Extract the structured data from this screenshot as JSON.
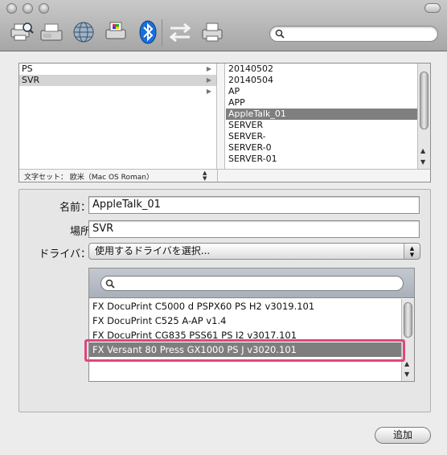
{
  "toolbar": {
    "icons": [
      "printer-search-icon",
      "fax-icon",
      "network-globe-icon",
      "windows-printer-icon",
      "bluetooth-icon",
      "transfer-arrows-icon",
      "printer-icon"
    ],
    "search_placeholder": ""
  },
  "browser": {
    "column1": [
      {
        "label": "PS",
        "state": "normal"
      },
      {
        "label": "SVR",
        "state": "selected"
      },
      {
        "label": "",
        "state": "normal"
      }
    ],
    "column2": [
      {
        "label": "20140502",
        "state": "normal"
      },
      {
        "label": "20140504",
        "state": "normal"
      },
      {
        "label": "AP",
        "state": "normal"
      },
      {
        "label": "APP",
        "state": "normal"
      },
      {
        "label": "AppleTalk_01",
        "state": "selected"
      },
      {
        "label": "SERVER",
        "state": "normal"
      },
      {
        "label": "SERVER-",
        "state": "normal"
      },
      {
        "label": "SERVER-0",
        "state": "normal"
      },
      {
        "label": "SERVER-01",
        "state": "normal"
      }
    ],
    "encoding_label": "文字セット： 欧米（Mac OS Roman）"
  },
  "form": {
    "name_label": "名前：",
    "name_value": "AppleTalk_01",
    "location_label": "場所",
    "location_value": "SVR",
    "driver_label": "ドライバ：",
    "driver_value": "使用するドライバを選択..."
  },
  "driver_list": {
    "search_placeholder": "",
    "items": [
      {
        "label": "FX DocuPrint C5000 d PSPX60 PS H2 v3019.101",
        "state": "normal"
      },
      {
        "label": "FX DocuPrint C525 A-AP v1.4",
        "state": "normal"
      },
      {
        "label": "FX DocuPrint CG835 PSS61 PS I2 v3017.101",
        "state": "normal"
      },
      {
        "label": "FX Versant 80 Press GX1000 PS J v3020.101",
        "state": "selected"
      }
    ]
  },
  "add_button": "追加",
  "colors": {
    "highlight": "#e0457f",
    "selection_dark": "#7f7f7f",
    "selection_grey": "#d4d4d4"
  }
}
